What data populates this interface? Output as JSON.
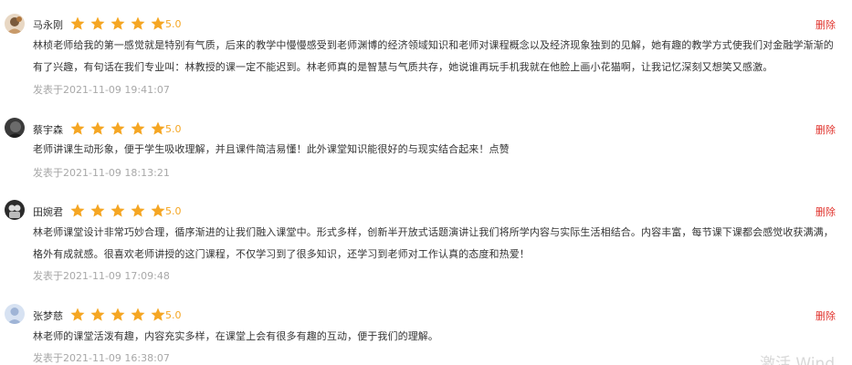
{
  "comments": [
    {
      "name": "马永刚",
      "score": "5.0",
      "rating": 5,
      "delete_label": "删除",
      "text": "林桢老师给我的第一感觉就是特别有气质，后来的教学中慢慢感受到老师渊博的经济领域知识和老师对课程概念以及经济现象独到的见解，她有趣的教学方式使我们对金融学渐渐的有了兴趣，有句话在我们专业叫：林教授的课一定不能迟到。林老师真的是智慧与气质共存，她说谁再玩手机我就在他脸上画小花猫啊，让我记忆深刻又想笑又感激。",
      "time": "发表于2021-11-09 19:41:07"
    },
    {
      "name": "蔡宇森",
      "score": "5.0",
      "rating": 5,
      "delete_label": "删除",
      "text": "老师讲课生动形象，便于学生吸收理解，并且课件简洁易懂！此外课堂知识能很好的与现实结合起来！点赞",
      "time": "发表于2021-11-09 18:13:21"
    },
    {
      "name": "田婉君",
      "score": "5.0",
      "rating": 5,
      "delete_label": "删除",
      "text": "林老师课堂设计非常巧妙合理，循序渐进的让我们融入课堂中。形式多样，创新半开放式话题演讲让我们将所学内容与实际生活相结合。内容丰富，每节课下课都会感觉收获满满，格外有成就感。很喜欢老师讲授的这门课程，不仅学习到了很多知识，还学习到老师对工作认真的态度和热爱！",
      "time": "发表于2021-11-09 17:09:48"
    },
    {
      "name": "张梦慈",
      "score": "5.0",
      "rating": 5,
      "delete_label": "删除",
      "text": "林老师的课堂活泼有趣，内容充实多样，在课堂上会有很多有趣的互动，便于我们的理解。",
      "time": "发表于2021-11-09 16:38:07"
    }
  ],
  "watermark": "激活 Wind",
  "colors": {
    "star": "#f5a623",
    "delete": "#e0312b",
    "time": "#a8a8a8",
    "text": "#333333"
  },
  "icons": {
    "avatar": "user-avatar-icon",
    "star": "star-icon"
  }
}
